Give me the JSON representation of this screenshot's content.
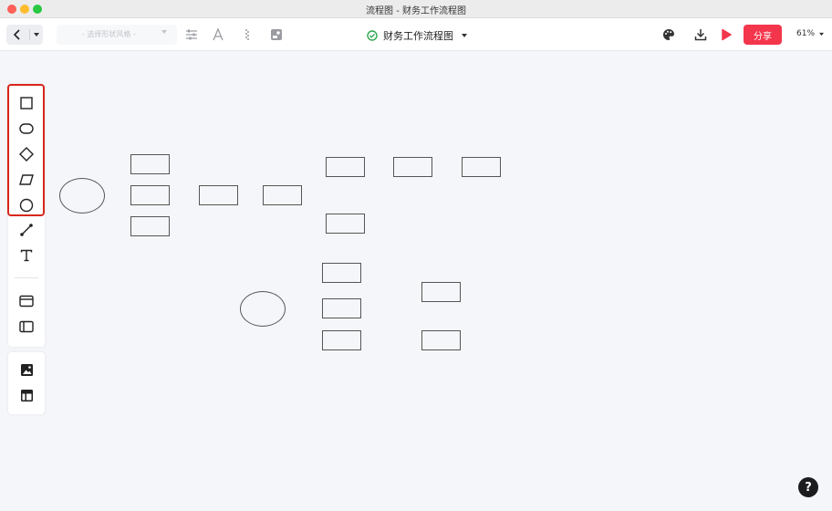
{
  "window": {
    "title": "流程图 - 财务工作流程图"
  },
  "toolbar": {
    "style_placeholder": "- 选择形状风格 -",
    "doc_title": "财务工作流程图",
    "share_label": "分享",
    "zoom": "61%"
  },
  "icons": {
    "back": "chevron-left-icon",
    "adjust": "sliders-icon",
    "font": "font-icon",
    "fill": "fill-icon",
    "image": "image-icon",
    "saved": "check-circle-icon",
    "palette": "palette-icon",
    "download": "download-icon",
    "present": "play-icon",
    "help": "?"
  },
  "palette": {
    "shapes": [
      "rectangle",
      "rounded-rectangle",
      "diamond",
      "parallelogram",
      "circle"
    ],
    "tools": [
      "connector",
      "text",
      "container",
      "swimlane",
      "image",
      "table"
    ]
  },
  "colors": {
    "accent": "#f4364c",
    "highlight": "#d8261b",
    "saved": "#2fa84f",
    "canvas": "#f5f6fa"
  }
}
